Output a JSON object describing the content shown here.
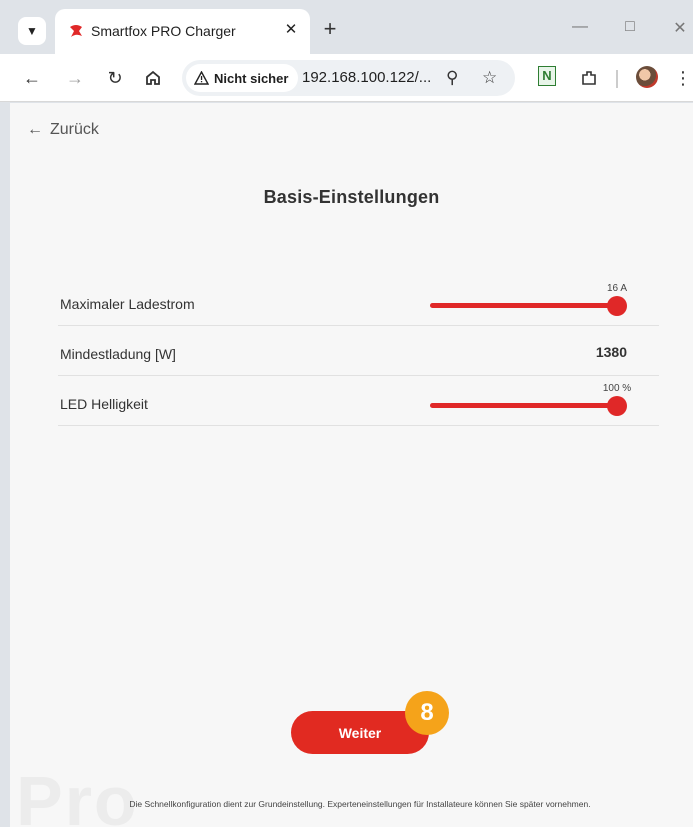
{
  "browser": {
    "tab": {
      "title": "Smartfox PRO Charger"
    },
    "toolbar": {
      "security_label": "Nicht sicher",
      "url": "192.168.100.122/...",
      "extension_letter": "N"
    }
  },
  "page": {
    "back_label": "Zurück",
    "title": "Basis-Einstellungen",
    "settings": [
      {
        "label": "Maximaler Ladestrom",
        "readout": "16 A",
        "level": 1.0
      },
      {
        "label": "Mindestladung [W]",
        "value": "1380"
      },
      {
        "label": "LED Helligkeit",
        "readout": "100 %",
        "level": 1.0
      }
    ],
    "next_label": "Weiter",
    "step_badge": "8",
    "watermark": "Pro",
    "footer_note": "Die Schnellkonfiguration dient zur Grundeinstellung. Experteneinstellungen für Installateure können Sie später vornehmen."
  },
  "colors": {
    "accent": "#e02828",
    "badge": "#f5a31a"
  },
  "icons": [
    "chevron-down-icon",
    "smartfox-icon",
    "close-icon",
    "plus-icon",
    "minimize-icon",
    "maximize-icon",
    "back-arrow-icon",
    "forward-arrow-icon",
    "reload-icon",
    "home-icon",
    "warning-icon",
    "zoom-icon",
    "star-icon",
    "extensions-icon",
    "kebab-menu-icon"
  ]
}
